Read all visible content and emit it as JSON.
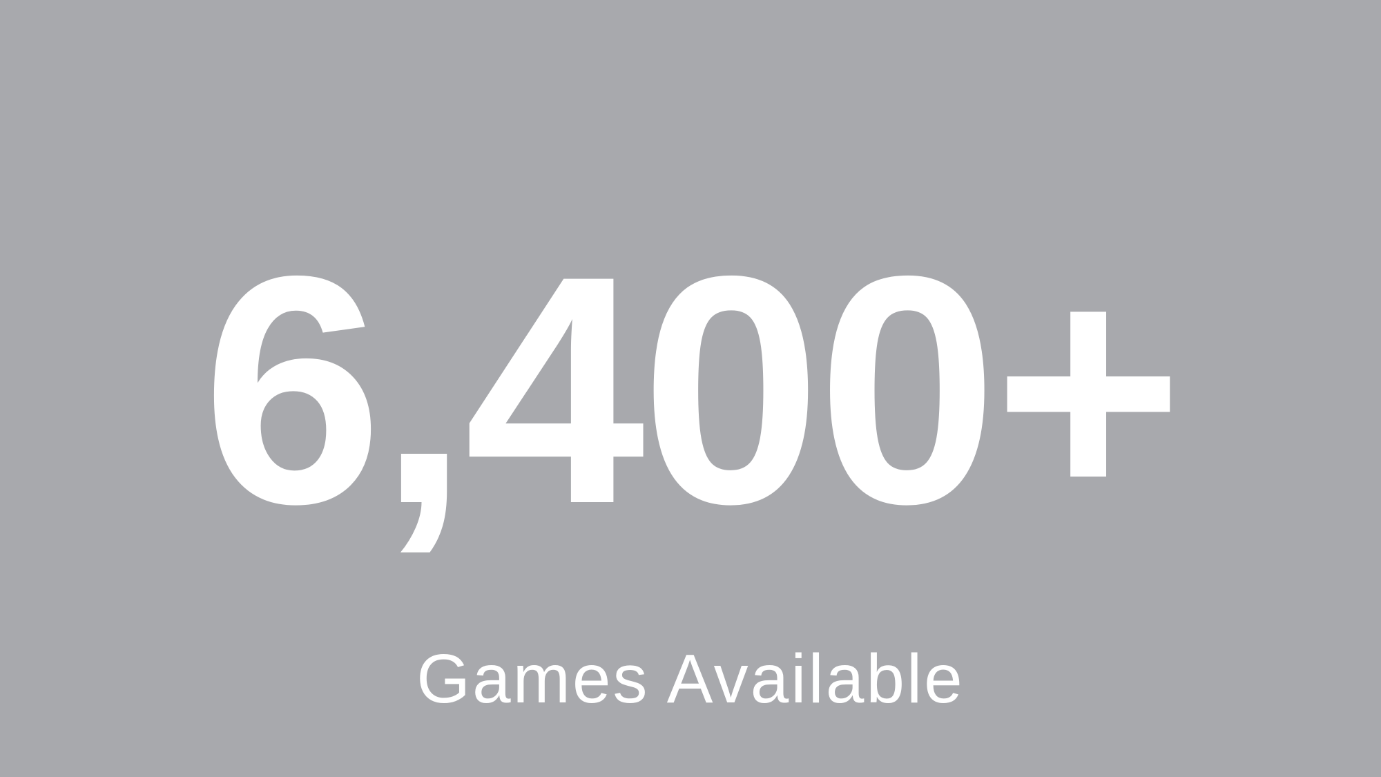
{
  "stat": {
    "value": "6,400+",
    "label": "Games Available"
  },
  "colors": {
    "background": "#a8a9ad",
    "text": "#ffffff"
  }
}
